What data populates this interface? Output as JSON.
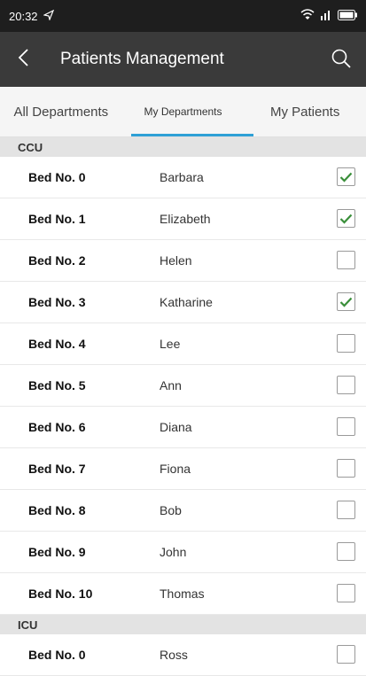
{
  "status_bar": {
    "time": "20:32"
  },
  "app_bar": {
    "title": "Patients Management"
  },
  "tabs": [
    {
      "label": "All Departments"
    },
    {
      "label": "My Departments"
    },
    {
      "label": "My Patients"
    }
  ],
  "colors": {
    "accent": "#2ea0d6",
    "check": "#3a8f3a"
  },
  "sections": [
    {
      "name": "CCU",
      "rows": [
        {
          "bed": "Bed No. 0",
          "patient": "Barbara",
          "checked": true
        },
        {
          "bed": "Bed No. 1",
          "patient": "Elizabeth",
          "checked": true
        },
        {
          "bed": "Bed No. 2",
          "patient": "Helen",
          "checked": false
        },
        {
          "bed": "Bed No. 3",
          "patient": "Katharine",
          "checked": true
        },
        {
          "bed": "Bed No. 4",
          "patient": "Lee",
          "checked": false
        },
        {
          "bed": "Bed No. 5",
          "patient": "Ann",
          "checked": false
        },
        {
          "bed": "Bed No. 6",
          "patient": "Diana",
          "checked": false
        },
        {
          "bed": "Bed No. 7",
          "patient": "Fiona",
          "checked": false
        },
        {
          "bed": "Bed No. 8",
          "patient": "Bob",
          "checked": false
        },
        {
          "bed": "Bed No. 9",
          "patient": "John",
          "checked": false
        },
        {
          "bed": "Bed No. 10",
          "patient": "Thomas",
          "checked": false
        }
      ]
    },
    {
      "name": "ICU",
      "rows": [
        {
          "bed": "Bed No. 0",
          "patient": "Ross",
          "checked": false
        }
      ]
    }
  ]
}
